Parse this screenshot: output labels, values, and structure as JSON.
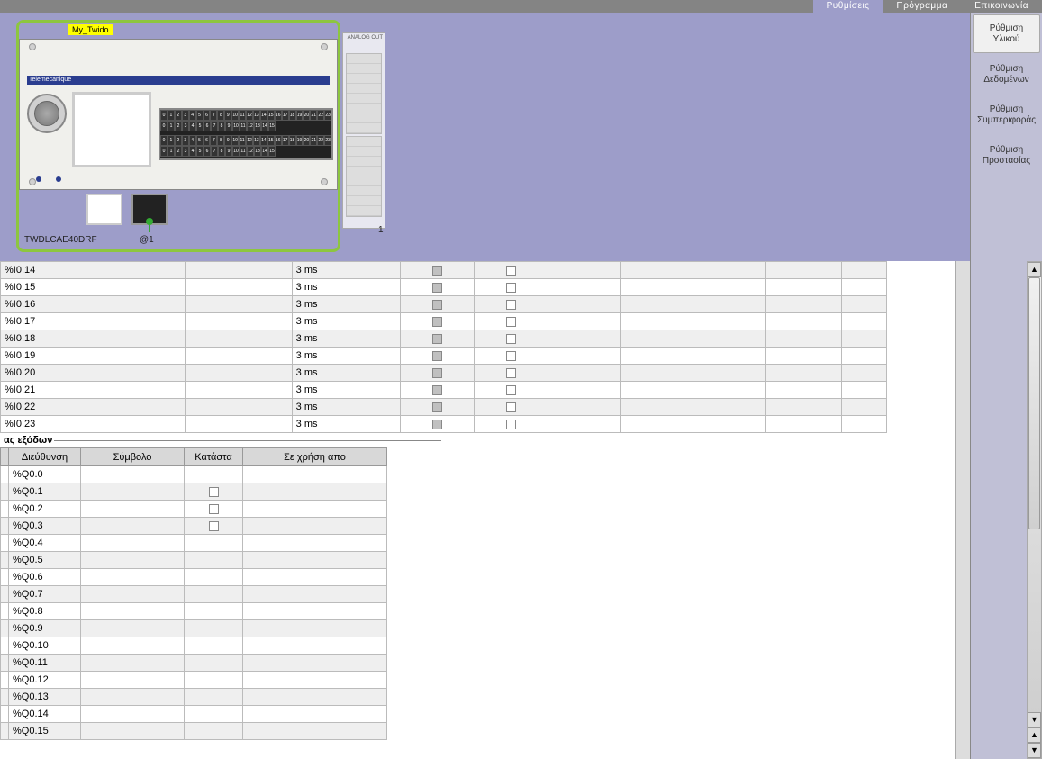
{
  "menu": {
    "settings": "Ρυθμίσεις",
    "program": "Πρόγραμμα",
    "comm": "Επικοινωνία"
  },
  "right_nav": {
    "hardware": {
      "l1": "Ρύθμιση",
      "l2": "Υλικού"
    },
    "data": {
      "l1": "Ρύθμιση",
      "l2": "Δεδομένων"
    },
    "behavior": {
      "l1": "Ρύθμιση",
      "l2": "Συμπεριφοράς"
    },
    "protection": {
      "l1": "Ρύθμιση",
      "l2": "Προστασίας"
    }
  },
  "plc": {
    "brand": "Telemecanique",
    "model": "TWDLCAE40DRF",
    "port_label": "@1",
    "ext_label": "1",
    "ext_top": "ANALOG OUT",
    "yellow_tag": "My_Twido"
  },
  "inputs": {
    "rows": [
      {
        "addr": "%I0.14",
        "filter": "3 ms"
      },
      {
        "addr": "%I0.15",
        "filter": "3 ms"
      },
      {
        "addr": "%I0.16",
        "filter": "3 ms"
      },
      {
        "addr": "%I0.17",
        "filter": "3 ms"
      },
      {
        "addr": "%I0.18",
        "filter": "3 ms"
      },
      {
        "addr": "%I0.19",
        "filter": "3 ms"
      },
      {
        "addr": "%I0.20",
        "filter": "3 ms"
      },
      {
        "addr": "%I0.21",
        "filter": "3 ms"
      },
      {
        "addr": "%I0.22",
        "filter": "3 ms"
      },
      {
        "addr": "%I0.23",
        "filter": "3 ms"
      }
    ]
  },
  "outputs": {
    "section_label": "ας εξόδων",
    "headers": {
      "addr": "Διεύθυνση",
      "symbol": "Σύμβολο",
      "state": "Κατάστα",
      "used_by": "Σε χρήση απο"
    },
    "rows": [
      {
        "addr": "%Q0.0",
        "has_check": false
      },
      {
        "addr": "%Q0.1",
        "has_check": true
      },
      {
        "addr": "%Q0.2",
        "has_check": true
      },
      {
        "addr": "%Q0.3",
        "has_check": true
      },
      {
        "addr": "%Q0.4",
        "has_check": false
      },
      {
        "addr": "%Q0.5",
        "has_check": false
      },
      {
        "addr": "%Q0.6",
        "has_check": false
      },
      {
        "addr": "%Q0.7",
        "has_check": false
      },
      {
        "addr": "%Q0.8",
        "has_check": false
      },
      {
        "addr": "%Q0.9",
        "has_check": false
      },
      {
        "addr": "%Q0.10",
        "has_check": false
      },
      {
        "addr": "%Q0.11",
        "has_check": false
      },
      {
        "addr": "%Q0.12",
        "has_check": false
      },
      {
        "addr": "%Q0.13",
        "has_check": false
      },
      {
        "addr": "%Q0.14",
        "has_check": false
      },
      {
        "addr": "%Q0.15",
        "has_check": false
      }
    ]
  }
}
